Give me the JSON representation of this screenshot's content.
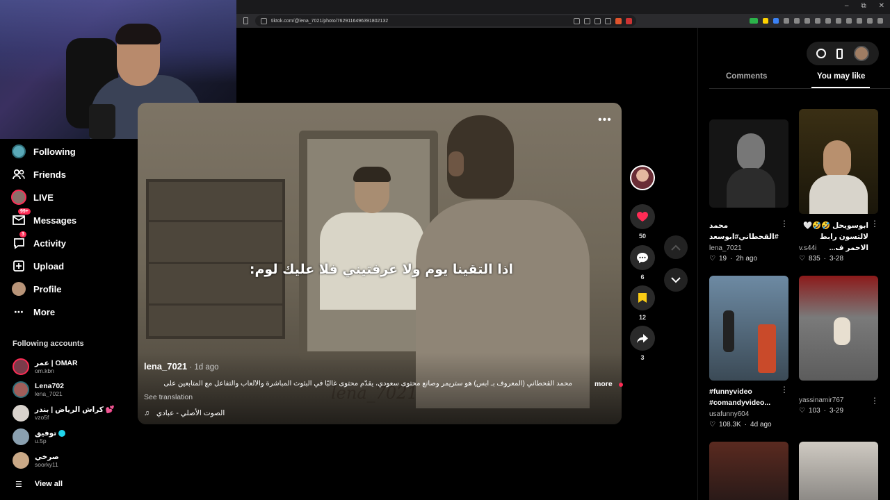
{
  "browser": {
    "url": "tiktok.com/@lena_7021/photo/7629116496391802132",
    "window_controls": [
      "–",
      "⧉",
      "✕"
    ]
  },
  "sidebar": {
    "nav": [
      {
        "label": "Following",
        "icon": "following-avatar-icon"
      },
      {
        "label": "Friends",
        "icon": "friends-icon"
      },
      {
        "label": "LIVE",
        "icon": "live-icon"
      },
      {
        "label": "Messages",
        "icon": "messages-icon",
        "badge": "99+"
      },
      {
        "label": "Activity",
        "icon": "activity-icon",
        "badge": "3"
      },
      {
        "label": "Upload",
        "icon": "upload-icon"
      },
      {
        "label": "Profile",
        "icon": "profile-icon"
      },
      {
        "label": "More",
        "icon": "more-icon"
      }
    ],
    "following_title": "Following accounts",
    "accounts": [
      {
        "name": "عمر | OMAR",
        "handle": "om.kbn",
        "color": "#7a3b4a"
      },
      {
        "name": "Lena702",
        "handle": "lena_7021",
        "color": "#a15e5a"
      },
      {
        "name": "كراش الرياض | بندر 💕",
        "handle": "vzo5f",
        "color": "#d8d2cc"
      },
      {
        "name": "توفيق",
        "handle": "u.5p",
        "color": "#8aa0b0",
        "verified": true
      },
      {
        "name": "صرخي",
        "handle": "soorky11",
        "color": "#c9a886"
      }
    ],
    "view_all": "View all"
  },
  "post": {
    "caption_overlay": "اذا التقينا يوم ولا عرفتيني فلا عليك لوم:",
    "watermark": "lena_7021",
    "author": "lena_7021",
    "age": "1d ago",
    "description": "محمد القحطاني (المعروف بـ ابس) هو ستريمر وصانع محتوى سعودي، يقدّم محتوى غالبًا في البثوث المباشرة والألعاب والتفاعل مع المتابعين على",
    "more_label": "more",
    "see_translation": "See translation",
    "sound": "الصوت الأصلي - عبادي",
    "likes": "50",
    "comments": "6",
    "saves": "12",
    "shares": "3",
    "accent": "#fe2c55",
    "save_color": "#facc15"
  },
  "right_panel": {
    "tabs": [
      "Comments",
      "You may like"
    ],
    "active_tab": "You may like",
    "cards": [
      {
        "title_line1": "محمد",
        "title_line2": "القحطاني#ابوسعد#fyp...",
        "user": "lena_7021",
        "likes": "19",
        "when": "2h ago",
        "bg": "#1b1b1b"
      },
      {
        "title_line1": "ابوسويحل 🤣🤣🤍",
        "title_line2": "لالتسون رابط الاحمر ف...",
        "user": "v.s44i",
        "likes": "835",
        "when": "3-28",
        "bg": "#2b2510"
      },
      {
        "title_line1": "#funnyvideo",
        "title_line2": "#comandyvideo...",
        "user": "usafunny604",
        "likes": "108.3K",
        "when": "4d ago",
        "bg": "#3d5770"
      },
      {
        "title_line1": "",
        "title_line2": "",
        "user": "yassinamir767",
        "likes": "103",
        "when": "3-29",
        "bg": "#6e6e6e"
      }
    ]
  }
}
